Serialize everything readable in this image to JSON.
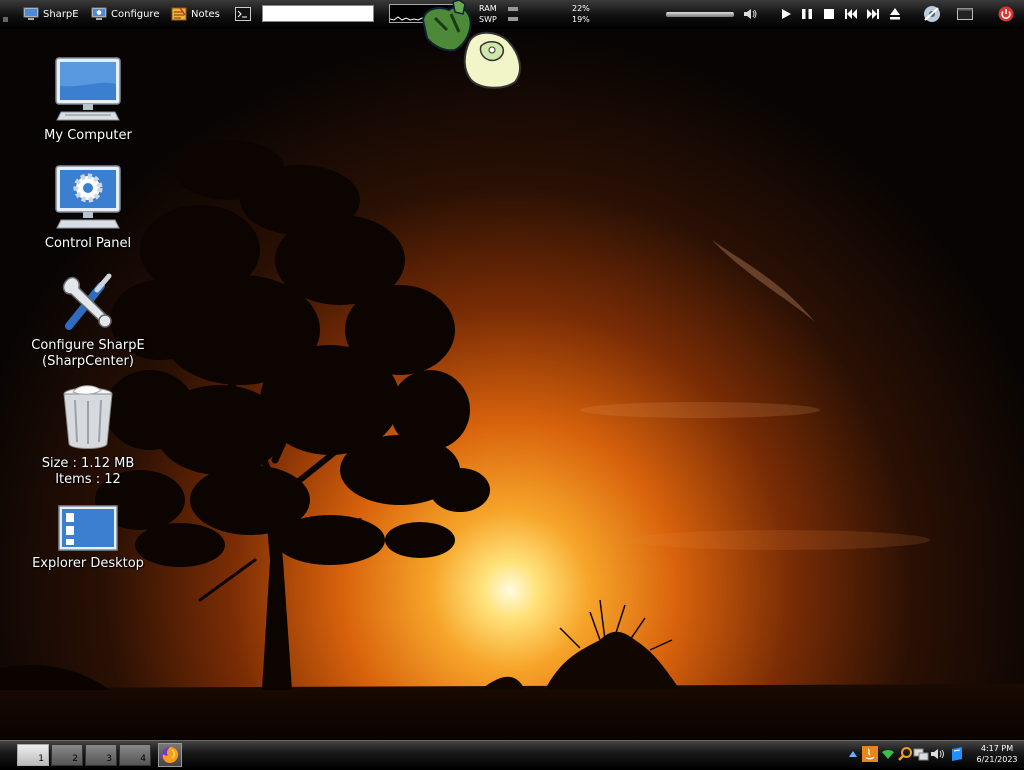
{
  "topbar": {
    "launchers": [
      {
        "label": "SharpE",
        "icon": "monitor-icon"
      },
      {
        "label": "Configure",
        "icon": "monitor-gear-icon"
      },
      {
        "label": "Notes",
        "icon": "notes-icon"
      }
    ],
    "terminal_icon": "terminal-icon",
    "command_input": {
      "value": "",
      "placeholder": ""
    },
    "memory": {
      "ram_label": "RAM",
      "ram_percent": "22%",
      "swap_label": "SWP",
      "swap_percent": "19%"
    },
    "volume_icon": "speaker-icon",
    "media_controls": [
      "play-icon",
      "pause-icon",
      "stop-icon",
      "previous-icon",
      "next-icon",
      "eject-icon"
    ],
    "power_icon": "power-icon"
  },
  "desktop": {
    "icons": [
      {
        "label": "My Computer",
        "icon": "computer-icon"
      },
      {
        "label": "Control Panel",
        "icon": "control-panel-icon"
      },
      {
        "label": "Configure SharpE\n(SharpCenter)",
        "line1": "Configure SharpE",
        "line2": "(SharpCenter)",
        "icon": "tools-icon"
      },
      {
        "label": "Recycle Bin",
        "line1": "Size : 1.12 MB",
        "line2": "Items : 12",
        "icon": "recycle-bin-icon"
      },
      {
        "label": "Explorer Desktop",
        "icon": "explorer-desktop-icon"
      }
    ]
  },
  "bottombar": {
    "workspaces": [
      "1",
      "2",
      "3",
      "4"
    ],
    "active_workspace": "1",
    "taskbar_app_icon": "firefox-icon",
    "tray_icons": [
      "expand-tray-icon",
      "java-icon",
      "network-shield-icon",
      "search-icon",
      "network-icon",
      "volume-icon",
      "dropbox-icon"
    ],
    "clock": {
      "time": "4:17 PM",
      "date": "6/21/2023"
    }
  },
  "colors": {
    "sky_top": "#0a0604",
    "sun": "#ffe9a0",
    "horizon": "#e0640a",
    "bar": "#111111"
  }
}
